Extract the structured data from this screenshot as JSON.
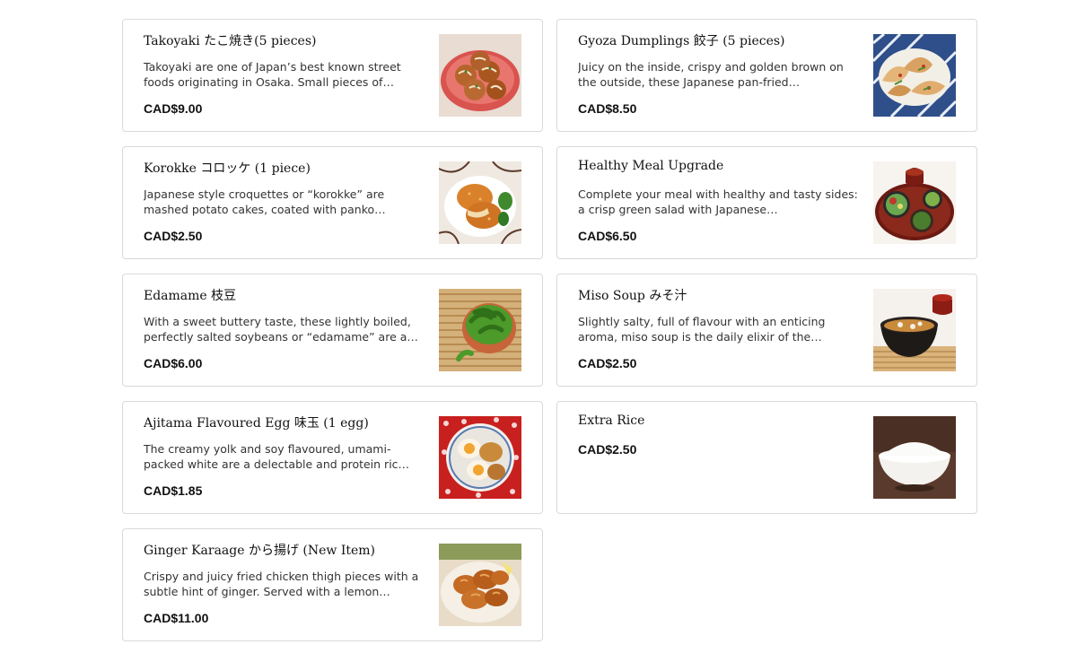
{
  "menu_items": [
    {
      "title": "Takoyaki たこ焼き(5 pieces)",
      "description": "Takoyaki are one of Japan’s best known street foods originating in Osaka. Small pieces of…",
      "price": "CAD$9.00",
      "image_icon": "takoyaki-photo"
    },
    {
      "title": "Gyoza Dumplings 餃子 (5 pieces)",
      "description": "Juicy on the inside, crispy and golden brown on the outside, these Japanese pan-fried…",
      "price": "CAD$8.50",
      "image_icon": "gyoza-photo"
    },
    {
      "title": "Korokke コロッケ (1 piece)",
      "description": "Japanese style croquettes or “korokke” are mashed potato cakes, coated with panko…",
      "price": "CAD$2.50",
      "image_icon": "korokke-photo"
    },
    {
      "title": "Healthy Meal Upgrade",
      "description": "Complete your meal with healthy and tasty sides: a crisp green salad with Japanese…",
      "price": "CAD$6.50",
      "image_icon": "healthy-meal-photo"
    },
    {
      "title": "Edamame 枝豆",
      "description": "With a sweet buttery taste, these lightly boiled, perfectly salted soybeans or “edamame” are a…",
      "price": "CAD$6.00",
      "image_icon": "edamame-photo"
    },
    {
      "title": "Miso Soup みそ汁",
      "description": "Slightly salty, full of flavour with an enticing aroma, miso soup is the daily elixir of the…",
      "price": "CAD$2.50",
      "image_icon": "miso-soup-photo"
    },
    {
      "title": "Ajitama Flavoured Egg 味玉 (1 egg)",
      "description": "The creamy yolk and soy flavoured, umami-packed white are a delectable and protein ric…",
      "price": "CAD$1.85",
      "image_icon": "ajitama-egg-photo"
    },
    {
      "title": "Extra Rice",
      "description": "",
      "price": "CAD$2.50",
      "image_icon": "rice-bowl-photo"
    },
    {
      "title": "Ginger Karaage から揚げ (New Item)",
      "description": "Crispy and juicy fried chicken thigh pieces with a subtle hint of ginger. Served with a lemon…",
      "price": "CAD$11.00",
      "image_icon": "karaage-photo"
    }
  ],
  "colors": {
    "card_border": "#d9d9d9",
    "text_primary": "#111111",
    "text_secondary": "#333333"
  }
}
